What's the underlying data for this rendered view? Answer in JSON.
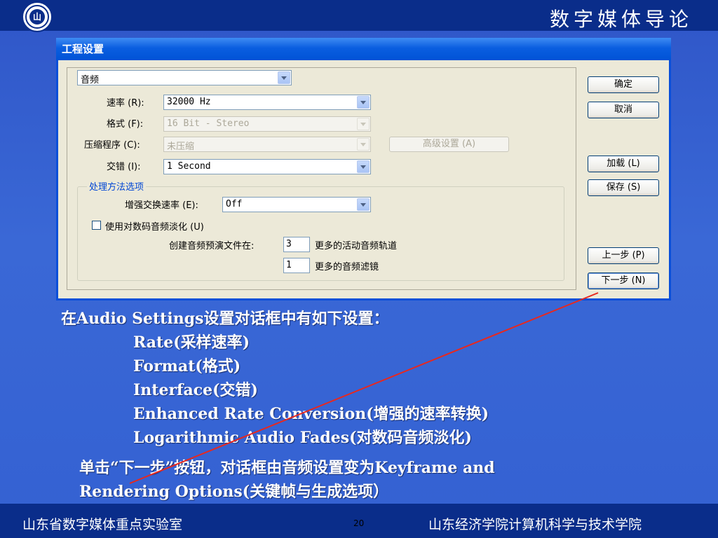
{
  "slide": {
    "title": "数字媒体导论",
    "logo_icon": "university-seal-icon",
    "footer_left": "山东省数字媒体重点实验室",
    "page_number": "20",
    "footer_right": "山东经济学院计算机科学与技术学院"
  },
  "dialog": {
    "title": "工程设置",
    "category_select": "音频",
    "rows": {
      "rate_label": "速率 (R):",
      "rate_value": "32000 Hz",
      "format_label": "格式 (F):",
      "format_value": "16 Bit - Stereo",
      "compressor_label": "压缩程序 (C):",
      "compressor_value": "未压缩",
      "advanced_button": "高级设置 (A)",
      "interleave_label": "交错 (I):",
      "interleave_value": "1 Second"
    },
    "processing": {
      "group_label": "处理方法选项",
      "enhanced_label": "增强交换速率 (E):",
      "enhanced_value": "Off",
      "log_fades_label": "使用对数码音频淡化 (U)",
      "preview_label": "创建音频预演文件在:",
      "active_tracks_value": "3",
      "active_tracks_label": "更多的活动音频轨道",
      "filters_value": "1",
      "filters_label": "更多的音频滤镜"
    },
    "buttons": {
      "ok": "确定",
      "cancel": "取消",
      "load": "加载 (L)",
      "save": "保存 (S)",
      "prev": "上一步 (P)",
      "next": "下一步 (N)"
    }
  },
  "annotation": {
    "intro": "在Audio Settings设置对话框中有如下设置：",
    "items": [
      "Rate(采样速率)",
      "Format(格式)",
      "Interface(交错)",
      "Enhanced Rate Conversion(增强的速率转换)",
      "Logarithmic Audio Fades(对数码音频淡化)"
    ],
    "outro_line1": "单击“下一步”按钮，对话框由音频设置变为Keyframe and",
    "outro_line2": "Rendering Options(关键帧与生成选项）"
  },
  "colors": {
    "slide_bg": "#3a68d6",
    "bar_bg": "#0a2d8a",
    "dialog_title": "#0a5ee0",
    "dialog_face": "#ece9d8",
    "arrow": "#e8281e",
    "group_label": "#0046d5"
  }
}
